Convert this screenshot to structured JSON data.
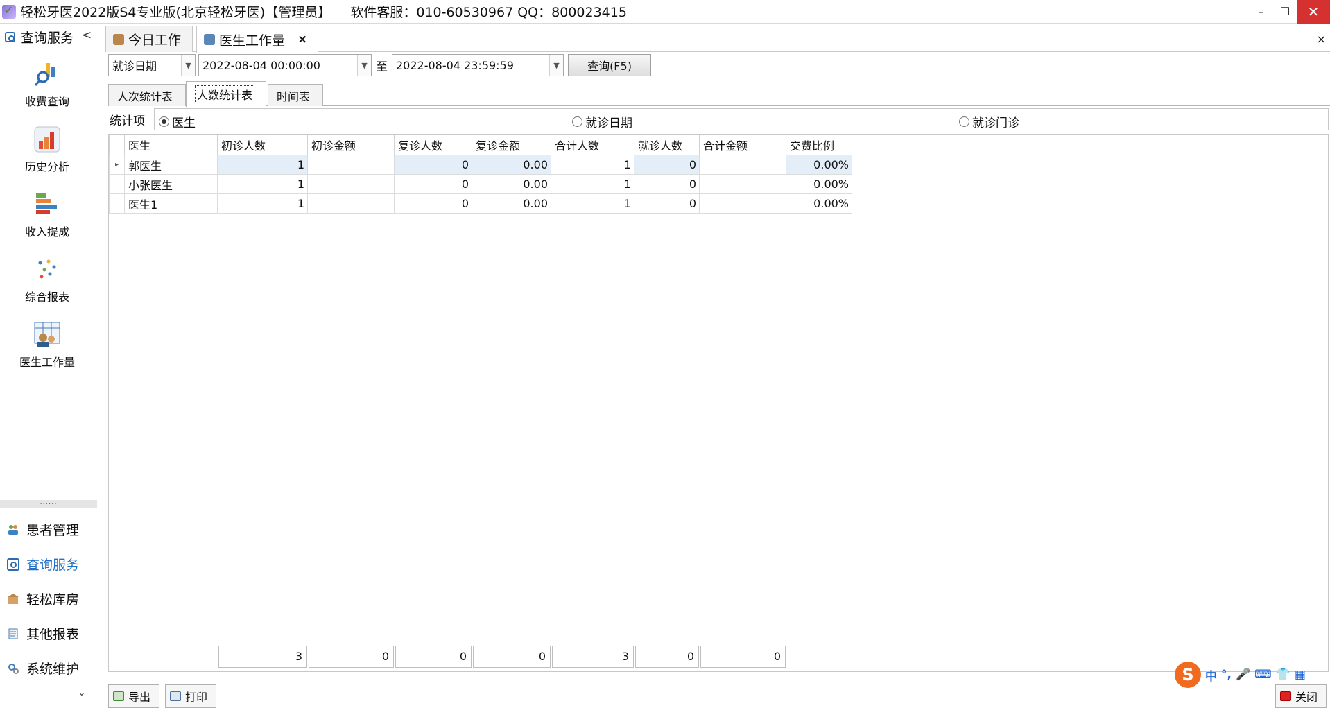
{
  "window": {
    "title": "轻松牙医2022版S4专业版(北京轻松牙医)【管理员】",
    "support": "软件客服：010-60530967 QQ：800023415",
    "min_icon": "minimize-icon",
    "restore_icon": "restore-icon",
    "close_icon": "close-icon"
  },
  "sidebar": {
    "header": "查询服务",
    "collapse_glyph": "<",
    "tiles": [
      {
        "label": "收费查询",
        "icon": "fee-query-icon"
      },
      {
        "label": "历史分析",
        "icon": "history-chart-icon"
      },
      {
        "label": "收入提成",
        "icon": "income-bars-icon"
      },
      {
        "label": "综合报表",
        "icon": "scatter-report-icon"
      },
      {
        "label": "医生工作量",
        "icon": "doctor-workload-icon"
      }
    ],
    "splitter": "......",
    "groups": [
      {
        "label": "患者管理",
        "icon": "patients-icon"
      },
      {
        "label": "查询服务",
        "icon": "query-icon"
      },
      {
        "label": "轻松库房",
        "icon": "warehouse-icon"
      },
      {
        "label": "其他报表",
        "icon": "reports-icon"
      },
      {
        "label": "系统维护",
        "icon": "maintenance-icon"
      }
    ],
    "expand_glyph": "⌄"
  },
  "doc_tabs": [
    {
      "label": "今日工作",
      "active": false
    },
    {
      "label": "医生工作量",
      "active": true,
      "close": "×"
    }
  ],
  "panel_close": "×",
  "filter": {
    "date_type": "就诊日期",
    "start": "2022-08-04 00:00:00",
    "to": "至",
    "end": "2022-08-04 23:59:59",
    "query_button": "查询(F5)"
  },
  "sub_tabs": [
    {
      "label": "人次统计表",
      "active": false
    },
    {
      "label": "人数统计表",
      "active": true
    },
    {
      "label": "时间表",
      "active": false
    }
  ],
  "stat": {
    "label": "统计项",
    "options": [
      {
        "label": "医生",
        "checked": true
      },
      {
        "label": "就诊日期",
        "checked": false
      },
      {
        "label": "就诊门诊",
        "checked": false
      }
    ]
  },
  "grid": {
    "columns": [
      "医生",
      "初诊人数",
      "初诊金额",
      "复诊人数",
      "复诊金额",
      "合计人数",
      "就诊人数",
      "合计金额",
      "交费比例"
    ],
    "rows": [
      [
        "郭医生",
        "1",
        "",
        "0",
        "0.00",
        "1",
        "0",
        "",
        "0.00%"
      ],
      [
        "小张医生",
        "1",
        "",
        "0",
        "0.00",
        "1",
        "0",
        "",
        "0.00%"
      ],
      [
        "医生1",
        "1",
        "",
        "0",
        "0.00",
        "1",
        "0",
        "",
        "0.00%"
      ]
    ],
    "row_indicator": "▸",
    "totals": [
      "3",
      "0",
      "0",
      "0",
      "3",
      "0",
      "0"
    ]
  },
  "bottom": {
    "export": "导出",
    "print": "打印",
    "close": "关闭"
  },
  "ime": {
    "logo": "S",
    "chinese": "中",
    "punct": "°,",
    "mic": "🎤",
    "keyboard": "⌨",
    "skin": "👕",
    "apps": "▦"
  }
}
